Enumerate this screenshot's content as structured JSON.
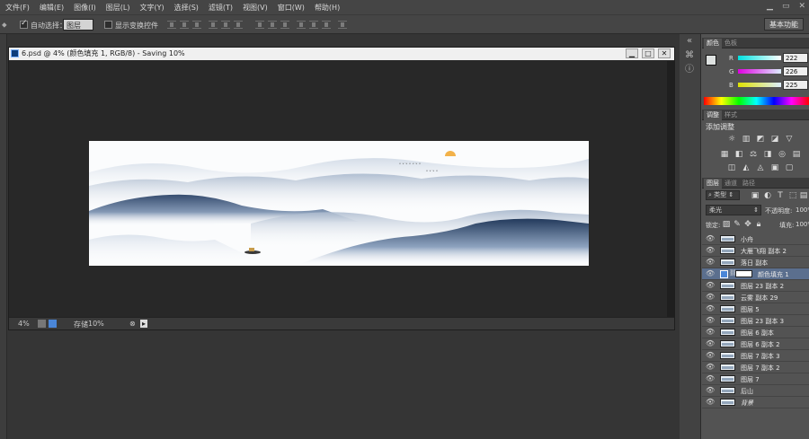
{
  "menu": [
    "文件(F)",
    "编辑(E)",
    "图像(I)",
    "图层(L)",
    "文字(Y)",
    "选择(S)",
    "滤镜(T)",
    "视图(V)",
    "窗口(W)",
    "帮助(H)"
  ],
  "options": {
    "auto_select_label": "自动选择：",
    "auto_select_value": "图层",
    "show_transform_label": "显示变换控件",
    "workspace": "基本功能"
  },
  "document": {
    "title": "6.psd @ 4% (颜色填充 1, RGB/8) - Saving 10%",
    "zoom": "4%",
    "status_label": "存储",
    "status_value": "10%"
  },
  "color_panel": {
    "tabs": [
      "颜色",
      "色板"
    ],
    "r_label": "R",
    "r": "222",
    "g_label": "G",
    "g": "226",
    "b_label": "B",
    "b": "225"
  },
  "adjust_panel": {
    "tabs": [
      "调整",
      "样式"
    ],
    "heading": "添加调整"
  },
  "layers_panel": {
    "tabs": [
      "图层",
      "通道",
      "路径"
    ],
    "filter_label": "类型",
    "blend_mode": "柔光",
    "opacity_label": "不透明度:",
    "opacity_value": "100%",
    "lock_label": "锁定:",
    "fill_label": "填充:",
    "fill_value": "100%",
    "layers": [
      {
        "name": "小舟",
        "selected": false
      },
      {
        "name": "大雁飞翔 副本 2",
        "selected": false
      },
      {
        "name": "落日 副本",
        "selected": false
      },
      {
        "name": "颜色填充 1",
        "selected": true
      },
      {
        "name": "图层 23 副本 2",
        "selected": false
      },
      {
        "name": "云雾 副本 29",
        "selected": false
      },
      {
        "name": "图层 5",
        "selected": false
      },
      {
        "name": "图层 23 副本 3",
        "selected": false
      },
      {
        "name": "图层 6 副本",
        "selected": false
      },
      {
        "name": "图层 6 副本 2",
        "selected": false
      },
      {
        "name": "图层 7 副本 3",
        "selected": false
      },
      {
        "name": "图层 7 副本 2",
        "selected": false
      },
      {
        "name": "图层 7",
        "selected": false
      },
      {
        "name": "后山",
        "selected": false
      },
      {
        "name": "背景",
        "selected": false
      }
    ]
  },
  "colors": {
    "accent_blue": "#4a86d8",
    "sun": "#f2b24a",
    "mountain_dark": "#2c4468"
  }
}
